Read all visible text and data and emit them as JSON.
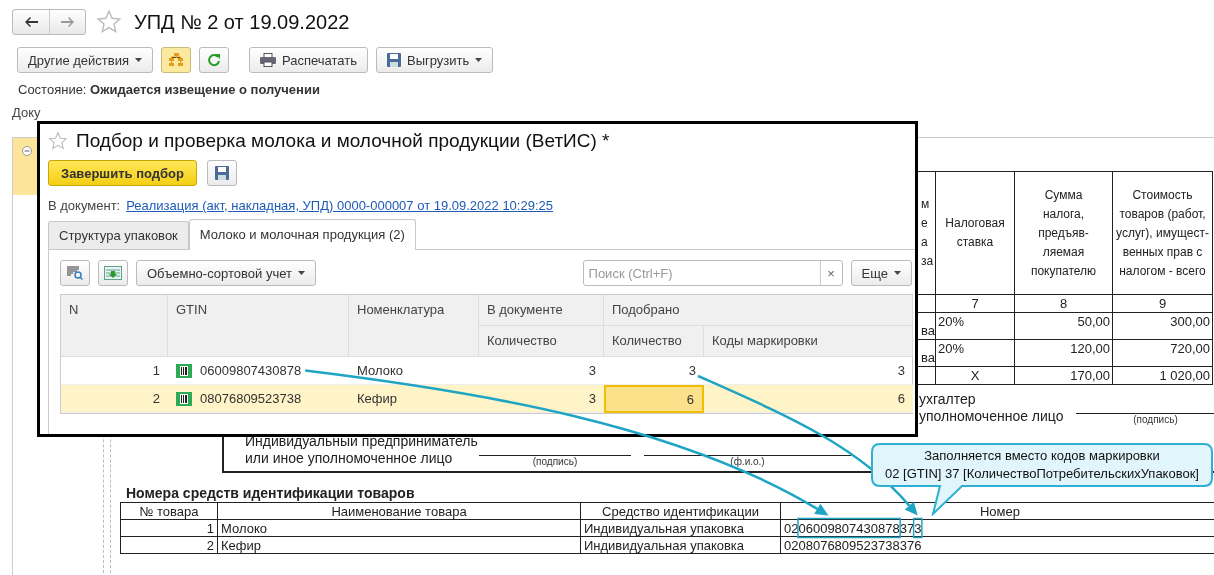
{
  "window": {
    "title": "УПД № 2 от 19.09.2022"
  },
  "toolbar": {
    "more_actions": "Другие действия",
    "structure_toggle": {
      "selected": true
    },
    "print": "Распечатать",
    "export": "Выгрузить"
  },
  "status": {
    "label": "Состояние:",
    "value": "Ожидается извещение о получении"
  },
  "accounting_docs_label": "Доку",
  "tax_table": {
    "columns": [
      {
        "label": "м\nе\nа\nза"
      },
      {
        "label": "Налоговая\nставка",
        "number": "7"
      },
      {
        "label": "Сумма\nналога,\nпредъяв-\nляемая\nпокупателю",
        "number": "8"
      },
      {
        "label": "Стоимость\nтоваров (работ,\nуслуг), имущест-\nвенных прав с\nналогом - всего",
        "number": "9"
      }
    ],
    "rows": [
      {
        "column_1": "ва",
        "rate": "20%",
        "tax": "50,00",
        "cost": "300,00"
      },
      {
        "column_1": "ва",
        "rate": "20%",
        "tax": "120,00",
        "cost": "720,00"
      }
    ],
    "total": {
      "rate": "X",
      "tax": "170,00",
      "cost": "1 020,00"
    }
  },
  "accountant": {
    "label": "ухгалтер\nуполномоченное лицо",
    "caption": "(подпись)"
  },
  "entrepreneur": {
    "label": "Индивидуальный предприниматель\nили иное уполномоченное лицо",
    "captions": [
      "(подпись)",
      "(ф.и.о.)"
    ]
  },
  "id_table": {
    "title": "Номера средств идентификации товаров",
    "columns": [
      "№ товара",
      "Наименование товара",
      "Средство идентификации",
      "Номер"
    ],
    "rows": [
      {
        "number": "1",
        "name": "Молоко",
        "means": "Индивидуальная упаковка",
        "code": "0206009807430878373"
      },
      {
        "number": "2",
        "name": "Кефир",
        "means": "Индивидуальная упаковка",
        "code": "0208076809523738376"
      }
    ]
  },
  "dialog": {
    "title": "Подбор и проверка молока и молочной продукции (ВетИС) *",
    "finish_button": "Завершить подбор",
    "document_label": "В документ:",
    "document_link": "Реализация (акт, накладная, УПД) 0000-000007 от 19.09.2022 10:29:25",
    "tabs": [
      {
        "label": "Структура упаковок",
        "selected": false
      },
      {
        "label": "Молоко и молочная продукция (2)",
        "selected": true
      }
    ],
    "view_mode": "Объемно-сортовой учет",
    "search": {
      "placeholder": "Поиск (Ctrl+F)",
      "clear": "×"
    },
    "more_button": "Еще",
    "columns": {
      "n": "N",
      "gtin": "GTIN",
      "name": "Номенклатура",
      "in_document": "В документе",
      "picked": "Подобрано",
      "quantity_doc": "Количество",
      "quantity_picked": "Количество",
      "codes": "Коды маркировки"
    },
    "rows": [
      {
        "n": "1",
        "gtin": "06009807430878",
        "name": "Молоко",
        "doc_qty": "3",
        "picked_qty": "3",
        "codes": "3",
        "selected": false
      },
      {
        "n": "2",
        "gtin": "08076809523738",
        "name": "Кефир",
        "doc_qty": "3",
        "picked_qty": "6",
        "codes": "6",
        "selected": true
      }
    ]
  },
  "callout": {
    "lines": [
      "Заполняется вместо кодов маркировки",
      "02 [GTIN] 37 [КоличествоПотребительскихУпаковок]"
    ]
  }
}
